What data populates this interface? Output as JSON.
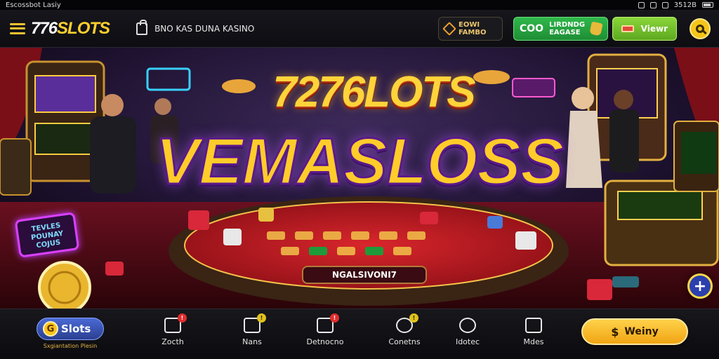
{
  "status_bar": {
    "left_text": "Escossbot Lasiy",
    "time": "3512B"
  },
  "header": {
    "logo_number": "776",
    "logo_word": "SLOTS",
    "store_label": "BNO KAS DUNA KASINO",
    "bonus_button": {
      "line1": "EOWI",
      "line2": "FAMBO"
    },
    "coin_button": {
      "amount": "COO",
      "line1": "LIRDNDG",
      "line2": "EAGASE"
    },
    "view_button": "Viewr"
  },
  "hero": {
    "title_top": "7276LOTS",
    "title_main": "VEMASLOSS",
    "sign_left": "TEVLES POUNAY COJUS",
    "table_label": "NGALSIVONI7"
  },
  "bottom_nav": {
    "brand": "Slots",
    "brand_coin": "G",
    "brand_sub": "Sxgiantation Plesin",
    "items": [
      {
        "label": "Zocth",
        "badge": "!",
        "badge_color": "red"
      },
      {
        "label": "Nans",
        "badge": "!",
        "badge_color": "yellow"
      },
      {
        "label": "Detnocno",
        "badge": "!",
        "badge_color": "red"
      },
      {
        "label": "Conetns",
        "badge": "!",
        "badge_color": "yellow"
      },
      {
        "label": "Idotec",
        "badge": "",
        "badge_color": ""
      },
      {
        "label": "Mdes",
        "badge": "",
        "badge_color": ""
      }
    ],
    "win_button": "Weiny",
    "win_icon": "$"
  },
  "colors": {
    "accent_gold": "#ffcf2e",
    "green_button": "#2fb84a",
    "nav_bg": "#0b0b0f"
  }
}
